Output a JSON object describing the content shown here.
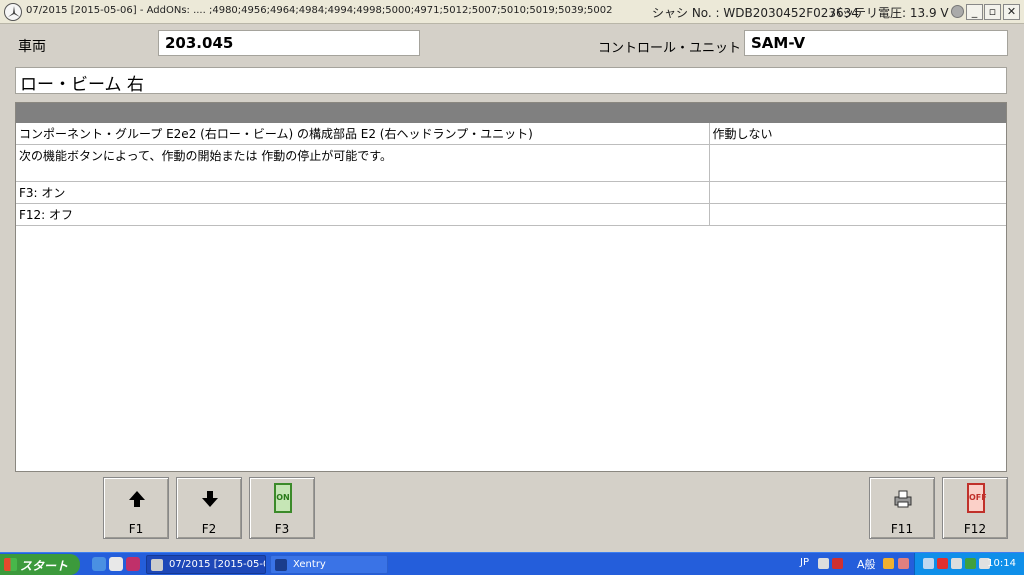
{
  "window": {
    "title": "07/2015 [2015-05-06] - AddONs: .... ;4980;4956;4964;4984;4994;4998;5000;4971;5012;5007;5010;5019;5039;5002",
    "chassis": "シャシ No. : WDB2030452F023634",
    "battery": "バッテリ電圧: 13.9 V"
  },
  "form": {
    "vehicle_label": "車両",
    "vehicle_value": "203.045",
    "control_unit_label": "コントロール・ユニット",
    "control_unit_value": "SAM-V",
    "component": "ロー・ビーム 右"
  },
  "table": {
    "rows": [
      [
        "コンポーネント・グループ E2e2 (右ロー・ビーム) の構成部品 E2 (右ヘッドランプ・ユニット)",
        "作動しない"
      ],
      [
        "次の機能ボタンによって、作動の開始または 作動の停止が可能です。",
        ""
      ],
      [
        "F3: オン",
        ""
      ],
      [
        "F12: オフ",
        ""
      ]
    ]
  },
  "fkeys": {
    "f1": "F1",
    "f2": "F2",
    "f3": "F3",
    "f3_icon_text": "ON",
    "f11": "F11",
    "f12": "F12",
    "f12_icon_text": "OFF"
  },
  "taskbar": {
    "start": "スタート",
    "task1": "07/2015 [2015-05-06...",
    "task2": "Xentry",
    "lang": "JP",
    "ime": "A般",
    "clock": "10:14"
  },
  "colors": {
    "taskbar": "#245edb",
    "start": "#3c9a3c",
    "header_bar": "#808080",
    "on_green": "#3b8a2a",
    "off_red": "#c0302a"
  }
}
